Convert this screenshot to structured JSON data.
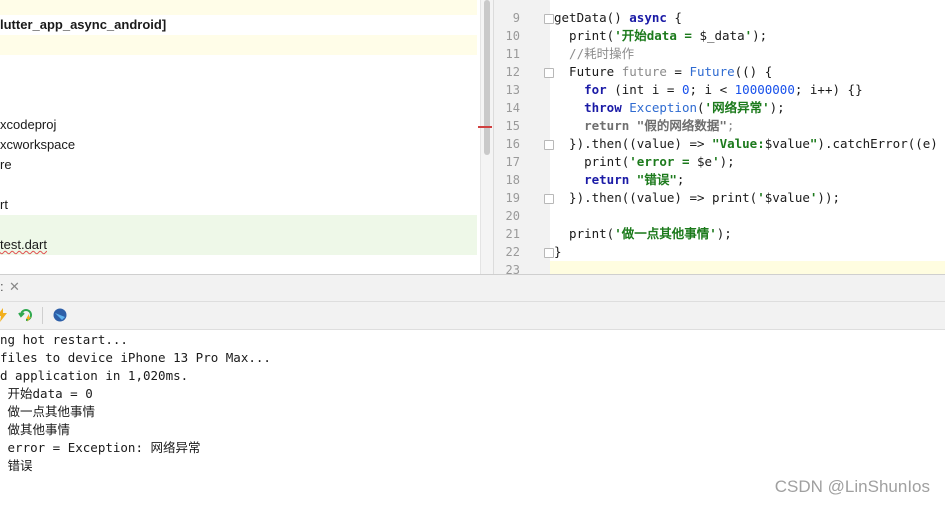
{
  "project_tree": {
    "rows": [
      {
        "text": "",
        "style": "yellow"
      },
      {
        "text": "lutter_app_async_android]",
        "style": "bold"
      },
      {
        "text": "",
        "style": "yellow"
      },
      {
        "text": "",
        "style": ""
      },
      {
        "text": "",
        "style": ""
      },
      {
        "text": "",
        "style": ""
      },
      {
        "text": "xcodeproj",
        "style": ""
      },
      {
        "text": "xcworkspace",
        "style": ""
      },
      {
        "text": "re",
        "style": ""
      },
      {
        "text": "",
        "style": ""
      },
      {
        "text": "rt",
        "style": ""
      },
      {
        "text": "",
        "style": "green"
      },
      {
        "text": "test.dart",
        "style": "green squiggle"
      }
    ]
  },
  "editor": {
    "line_numbers": [
      "9",
      "10",
      "11",
      "12",
      "13",
      "14",
      "15",
      "16",
      "17",
      "18",
      "19",
      "20",
      "21",
      "22",
      "23"
    ],
    "lines": [
      [
        {
          "t": "getData() ",
          "c": ""
        },
        {
          "t": "async",
          "c": "kw"
        },
        {
          "t": " {",
          "c": ""
        }
      ],
      [
        {
          "t": "  print(",
          "c": ""
        },
        {
          "t": "'开始data = ",
          "c": "str"
        },
        {
          "t": "$_data",
          "c": ""
        },
        {
          "t": "'",
          "c": "str"
        },
        {
          "t": ");",
          "c": ""
        }
      ],
      [
        {
          "t": "  //耗时操作",
          "c": "cmt"
        }
      ],
      [
        {
          "t": "  Future ",
          "c": ""
        },
        {
          "t": "future",
          "c": "gray"
        },
        {
          "t": " = ",
          "c": ""
        },
        {
          "t": "Future",
          "c": "cls"
        },
        {
          "t": "(() {",
          "c": ""
        }
      ],
      [
        {
          "t": "    ",
          "c": ""
        },
        {
          "t": "for",
          "c": "kw"
        },
        {
          "t": " (int i = ",
          "c": ""
        },
        {
          "t": "0",
          "c": "num"
        },
        {
          "t": "; i < ",
          "c": ""
        },
        {
          "t": "10000000",
          "c": "num"
        },
        {
          "t": "; i++) {}",
          "c": ""
        }
      ],
      [
        {
          "t": "    ",
          "c": ""
        },
        {
          "t": "throw",
          "c": "kw"
        },
        {
          "t": " ",
          "c": ""
        },
        {
          "t": "Exception",
          "c": "cls"
        },
        {
          "t": "(",
          "c": ""
        },
        {
          "t": "'网络异常'",
          "c": "str"
        },
        {
          "t": ");",
          "c": ""
        }
      ],
      [
        {
          "t": "    ",
          "c": ""
        },
        {
          "t": "return",
          "c": "muted"
        },
        {
          "t": " ",
          "c": ""
        },
        {
          "t": "\"假的网络数据\"",
          "c": "muted"
        },
        {
          "t": ";",
          "c": "gray"
        }
      ],
      [
        {
          "t": "  }).then((value) => ",
          "c": ""
        },
        {
          "t": "\"Value:",
          "c": "str"
        },
        {
          "t": "$value",
          "c": ""
        },
        {
          "t": "\"",
          "c": "str"
        },
        {
          "t": ").catchError((e) {  /",
          "c": ""
        }
      ],
      [
        {
          "t": "    print(",
          "c": ""
        },
        {
          "t": "'error = ",
          "c": "str"
        },
        {
          "t": "$e",
          "c": ""
        },
        {
          "t": "'",
          "c": "str"
        },
        {
          "t": ");",
          "c": ""
        }
      ],
      [
        {
          "t": "    ",
          "c": ""
        },
        {
          "t": "return",
          "c": "kw"
        },
        {
          "t": " ",
          "c": ""
        },
        {
          "t": "\"错误\"",
          "c": "str"
        },
        {
          "t": ";",
          "c": ""
        }
      ],
      [
        {
          "t": "  }).then((value) => print(",
          "c": ""
        },
        {
          "t": "'",
          "c": "str"
        },
        {
          "t": "$value",
          "c": ""
        },
        {
          "t": "'",
          "c": "str"
        },
        {
          "t": "));",
          "c": ""
        }
      ],
      [
        {
          "t": "",
          "c": ""
        }
      ],
      [
        {
          "t": "  print(",
          "c": ""
        },
        {
          "t": "'做一点其他事情'",
          "c": "str"
        },
        {
          "t": ");",
          "c": ""
        }
      ],
      [
        {
          "t": "}",
          "c": ""
        }
      ],
      [
        {
          "t": "",
          "c": ""
        }
      ]
    ],
    "highlight_line_index": 14,
    "fold_line_indexes": [
      0,
      3,
      7,
      10,
      13
    ]
  },
  "run_panel": {
    "tab_tail": ":",
    "console_lines": [
      "ng hot restart...",
      "files to device iPhone 13 Pro Max...",
      "d application in 1,020ms.",
      " 开始data = 0",
      " 做一点其他事情",
      " 做其他事情",
      " error = Exception: 网络异常",
      " 错误"
    ]
  },
  "watermark": "CSDN @LinShunIos"
}
